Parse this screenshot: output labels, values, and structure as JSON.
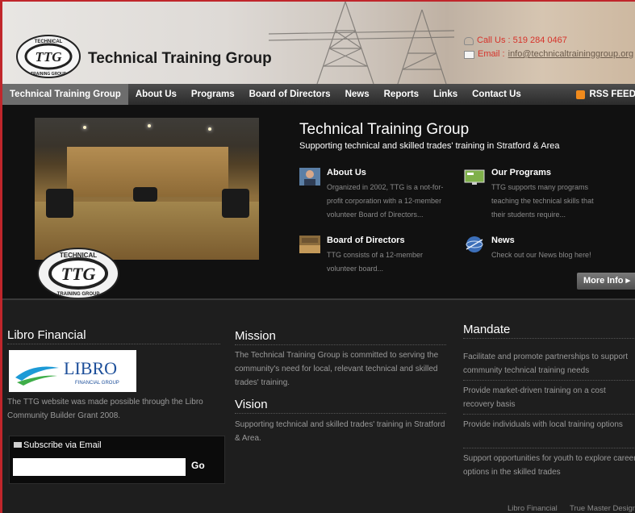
{
  "header": {
    "site_title": "Technical Training Group",
    "phone_label": "Call Us : 519 284 0467",
    "email_prefix": "Email : ",
    "email_link": "info@technicaltraininggroup.org",
    "logo_text_top": "TECHNICAL",
    "logo_text_center": "TTG",
    "logo_text_bottom": "TRAINING GROUP"
  },
  "nav": {
    "items": [
      {
        "label": "Technical Training Group"
      },
      {
        "label": "About Us"
      },
      {
        "label": "Programs"
      },
      {
        "label": "Board of Directors"
      },
      {
        "label": "News"
      },
      {
        "label": "Reports"
      },
      {
        "label": "Links"
      },
      {
        "label": "Contact Us"
      }
    ],
    "rss_label": "RSS FEED"
  },
  "hero": {
    "title": "Technical Training Group",
    "subtitle": "Supporting technical and skilled trades' training in Stratford & Area",
    "features": [
      {
        "title": "About Us",
        "desc": "Organized in 2002, TTG is a not-for-profit corporation with a 12-member volunteer Board of Directors...",
        "icon": "person-icon"
      },
      {
        "title": "Our Programs",
        "desc": "TTG supports many programs teaching the technical skills that their students require...",
        "icon": "monitor-icon"
      },
      {
        "title": "Board of Directors",
        "desc": "TTG consists of a 12-member volunteer board...",
        "icon": "boardroom-icon"
      },
      {
        "title": "News",
        "desc": "Check out our News blog here!",
        "icon": "globe-icon"
      }
    ],
    "more_info_label": "More Info ▸"
  },
  "libro": {
    "heading": "Libro Financial",
    "logo_word": "LIBRO",
    "logo_sub": "FINANCIAL GROUP",
    "text": "The TTG website was made possible through the Libro Community Builder Grant 2008."
  },
  "subscribe": {
    "title": "Subscribe via Email",
    "input_value": "",
    "go_label": "Go"
  },
  "mission": {
    "heading": "Mission",
    "text": "The Technical Training Group is committed to serving the community's need for local, relevant technical and skilled trades' training."
  },
  "vision": {
    "heading": "Vision",
    "text": "Supporting technical and skilled trades' training in Stratford & Area."
  },
  "mandate": {
    "heading": "Mandate",
    "items": [
      "Facilitate and promote partnerships to support community technical training needs",
      "Provide market-driven training on a cost recovery basis",
      "Provide individuals with local training options",
      "Support opportunities for youth to explore career options in the skilled trades"
    ]
  },
  "footer": {
    "links": [
      "Libro Financial",
      "True Master Design"
    ]
  },
  "colors": {
    "accent_red": "#d6322a",
    "nav_active": "#6d6d6d",
    "rss_orange": "#f08a1c",
    "libro_blue": "#1d4f9a",
    "libro_green": "#3fae49"
  }
}
